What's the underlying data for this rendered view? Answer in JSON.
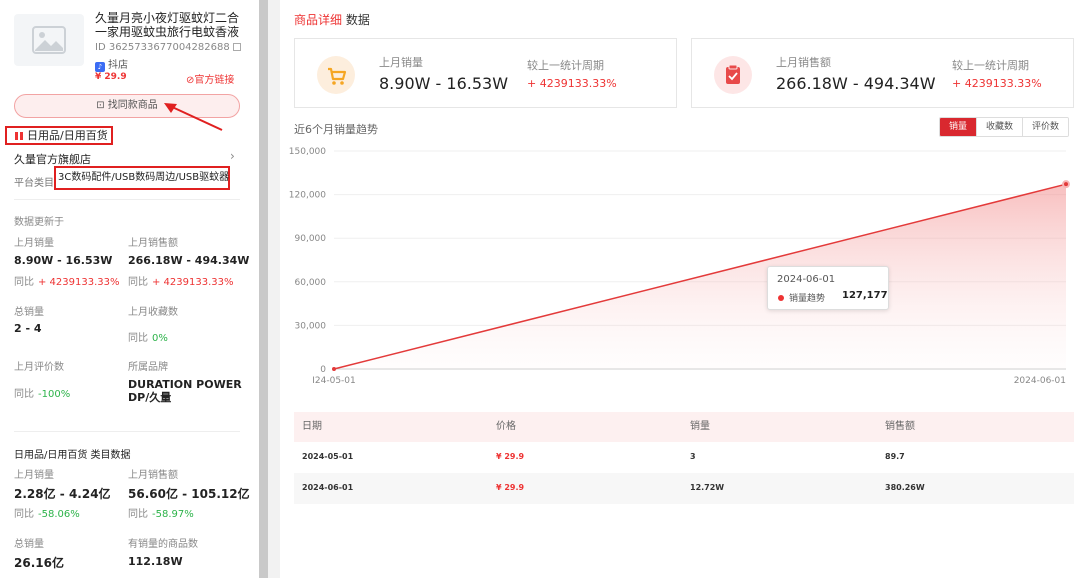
{
  "product": {
    "title": "久量月亮小夜灯驱蚊灯二合一家用驱蚊虫旅行电蚊香液",
    "id": "ID 3625733677004282688",
    "platform_tag": "抖店",
    "price": "¥ 29.9",
    "official_link": "官方链接",
    "find_same_button": "找同款商品",
    "category": "日用品/日用百货",
    "store": "久量官方旗舰店",
    "platform_category_label": "平台类目",
    "platform_category": "3C数码配件/USB数码周边/USB驱蚊器"
  },
  "stats": {
    "updated_label": "数据更新于",
    "last_month_sales_label": "上月销量",
    "last_month_sales": "8.90W - 16.53W",
    "last_month_sales_cmp_label": "同比",
    "last_month_sales_cmp": "+ 4239133.33%",
    "last_month_revenue_label": "上月销售额",
    "last_month_revenue": "266.18W - 494.34W",
    "last_month_revenue_cmp_label": "同比",
    "last_month_revenue_cmp": "+ 4239133.33%",
    "total_sales_label": "总销量",
    "total_sales": "2 - 4",
    "last_month_fav_label": "上月收藏数",
    "last_month_fav_cmp_label": "同比",
    "last_month_fav_cmp": "0%",
    "last_month_reviews_label": "上月评价数",
    "last_month_reviews_cmp_label": "同比",
    "last_month_reviews_cmp": "-100%",
    "brand_label": "所属品牌",
    "brand": "DURATION POWER DP/久量"
  },
  "category_stats": {
    "title": "日用品/日用百货 类目数据",
    "sales_label": "上月销量",
    "sales": "2.28亿 - 4.24亿",
    "sales_cmp_label": "同比",
    "sales_cmp": "-58.06%",
    "revenue_label": "上月销售额",
    "revenue": "56.60亿 - 105.12亿",
    "revenue_cmp_label": "同比",
    "revenue_cmp": "-58.97%",
    "total_sales_label": "总销量",
    "total_sales": "26.16亿",
    "products_label": "有销量的商品数",
    "products": "112.18W"
  },
  "header": {
    "crumb_link": "商品详细",
    "crumb_rest": "数据"
  },
  "cards": {
    "sales_label": "上月销量",
    "sales_value": "8.90W - 16.53W",
    "sales_cmp_label": "较上一统计周期",
    "sales_cmp": "+ 4239133.33%",
    "revenue_label": "上月销售额",
    "revenue_value": "266.18W - 494.34W",
    "revenue_cmp_label": "较上一统计周期",
    "revenue_cmp": "+ 4239133.33%"
  },
  "trend": {
    "title": "近6个月销量趋势",
    "tabs": [
      "销量",
      "收藏数",
      "评价数"
    ],
    "active_tab": 0,
    "tooltip_date": "2024-06-01",
    "tooltip_series": "销量趋势",
    "tooltip_value": "127,177"
  },
  "chart_data": {
    "type": "area",
    "x": [
      "2024-05-01",
      "2024-06-01"
    ],
    "x_tick_labels": [
      "I24-05-01",
      "2024-06-01"
    ],
    "series": [
      {
        "name": "销量趋势",
        "values": [
          3,
          127177
        ]
      }
    ],
    "ylim": [
      0,
      150000
    ],
    "yticks": [
      0,
      30000,
      60000,
      90000,
      120000,
      150000
    ],
    "ytick_labels": [
      "0",
      "30,000",
      "60,000",
      "90,000",
      "120,000",
      "150,000"
    ],
    "grid": true,
    "color": "#e33a3a"
  },
  "table": {
    "headers": [
      "日期",
      "价格",
      "销量",
      "销售额"
    ],
    "rows": [
      [
        "2024-05-01",
        "¥ 29.9",
        "3",
        "89.7"
      ],
      [
        "2024-06-01",
        "¥ 29.9",
        "12.72W",
        "380.26W"
      ]
    ]
  },
  "colors": {
    "accent": "#e33a3a",
    "tab_active": "#d9282f",
    "positive": "#e33a3a",
    "negative": "#2db34a"
  }
}
